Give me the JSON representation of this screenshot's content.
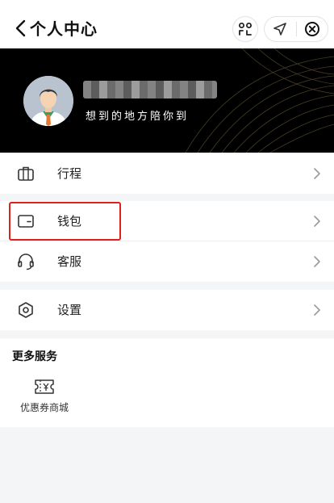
{
  "header": {
    "title": "个人中心",
    "back_icon": "chevron-left-icon",
    "scan_icon": "scan-icon",
    "location_icon": "location-arrow-icon",
    "close_icon": "close-circle-icon"
  },
  "profile": {
    "username": "",
    "signature": "想到的地方陪你到",
    "avatar_icon": "default-avatar"
  },
  "menu": {
    "groups": [
      {
        "items": [
          {
            "label": "行程",
            "icon": "briefcase-icon"
          }
        ]
      },
      {
        "items": [
          {
            "label": "钱包",
            "icon": "wallet-icon"
          },
          {
            "label": "客服",
            "icon": "headset-icon"
          }
        ]
      },
      {
        "items": [
          {
            "label": "设置",
            "icon": "settings-icon"
          }
        ]
      }
    ]
  },
  "services": {
    "title": "更多服务",
    "items": [
      {
        "label": "优惠券商城",
        "icon": "coupon-icon"
      }
    ]
  },
  "colors": {
    "accent_highlight": "#e0201a",
    "banner_bg": "#000000",
    "page_bg": "#f4f5f7"
  }
}
